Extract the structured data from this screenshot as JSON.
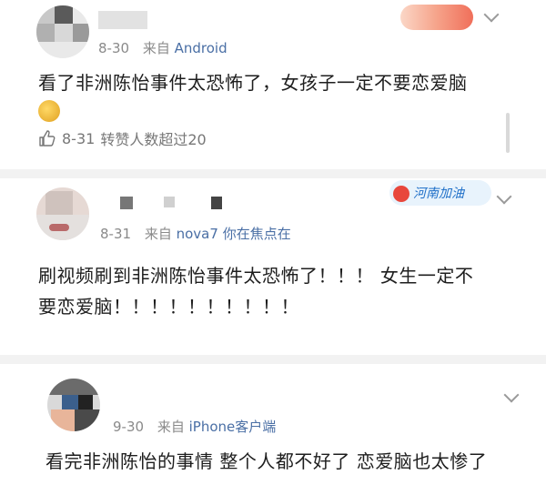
{
  "comments": [
    {
      "date": "8-30",
      "source_prefix": "来自",
      "source": "Android",
      "text": "看了非洲陈怡事件太恐怖了，女孩子一定不要恋爱脑",
      "like_row": {
        "date": "8-31",
        "text": "转赞人数超过20"
      }
    },
    {
      "date": "8-31",
      "source_prefix": "来自",
      "source": "nova7 你在焦点在",
      "badge": "河南加油",
      "text_line1": "刷视频刷到非洲陈怡事件太恐怖了！！！ 女生一定不",
      "text_line2": "要恋爱脑！！！！！！！！！！"
    },
    {
      "date": "9-30",
      "source_prefix": "来自",
      "source": "iPhone客户端",
      "text": "看完非洲陈怡的事情 整个人都不好了 恋爱脑也太惨了"
    }
  ],
  "colors": {
    "source_link": "#4a6fa5",
    "meta": "#8a8a8a",
    "separator": "#f2f2f2"
  }
}
